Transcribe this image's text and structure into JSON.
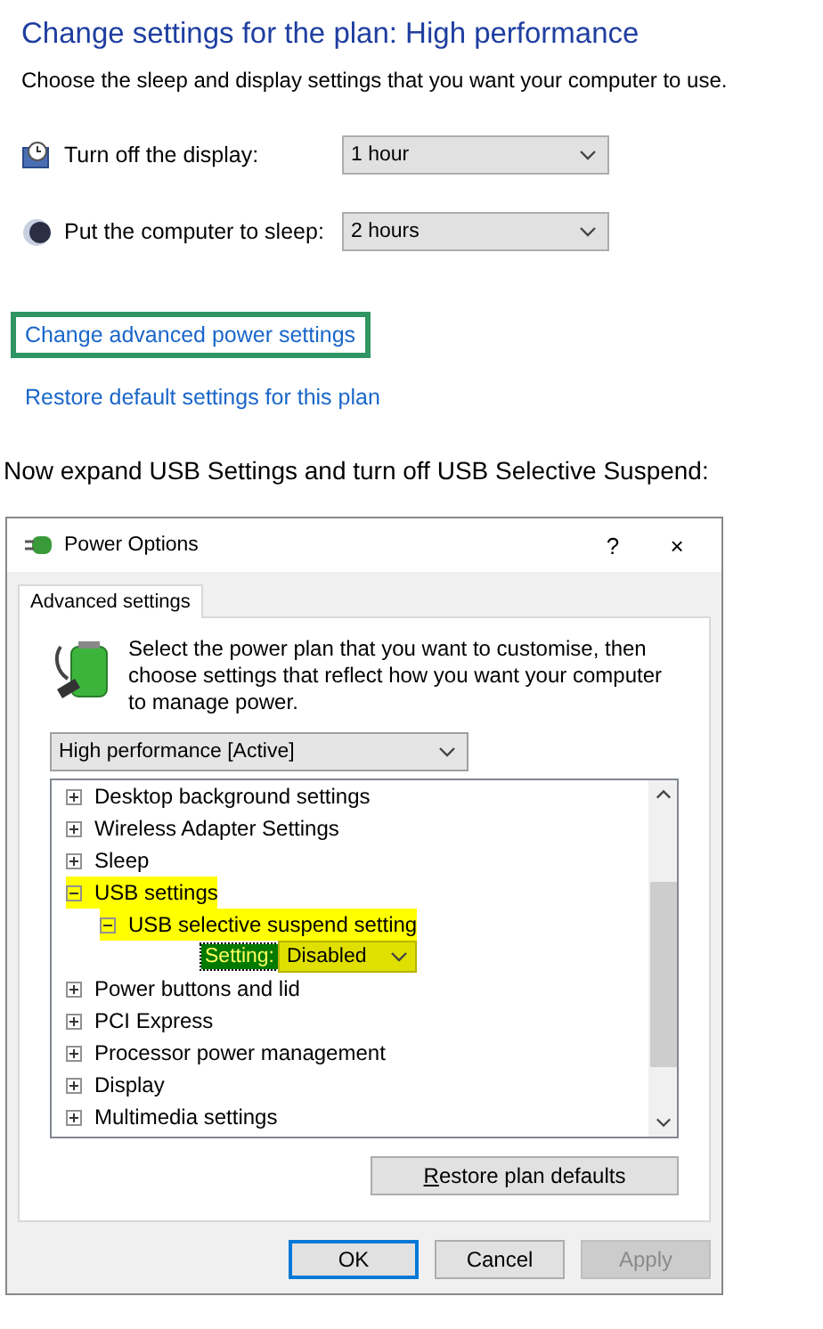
{
  "page": {
    "title": "Change settings for the plan: High performance",
    "subtitle": "Choose the sleep and display settings that you want your computer to use."
  },
  "settings": [
    {
      "kind": "display",
      "label": "Turn off the display:",
      "value": "1 hour"
    },
    {
      "kind": "sleep",
      "label": "Put the computer to sleep:",
      "value": "2 hours"
    }
  ],
  "links": [
    {
      "label": "Change advanced power settings",
      "outlined": true
    },
    {
      "label": "Restore default settings for this plan",
      "outlined": false
    }
  ],
  "instruction": "Now expand USB Settings and turn off USB Selective Suspend:",
  "dialog": {
    "title": "Power Options",
    "help": "?",
    "close": "×",
    "tabs": [
      {
        "label": "Advanced settings",
        "selected": true
      }
    ],
    "description": "Select the power plan that you want to customise, then choose settings that reflect how you want your computer to manage power.",
    "plan": "High performance [Active]",
    "tree": [
      {
        "kind": "node",
        "label": "Desktop background settings",
        "expanded": false,
        "highlighted": false
      },
      {
        "kind": "node",
        "label": "Wireless Adapter Settings",
        "expanded": false,
        "highlighted": false
      },
      {
        "kind": "node",
        "label": "Sleep",
        "expanded": false,
        "highlighted": false
      },
      {
        "kind": "node",
        "label": "USB settings",
        "expanded": true,
        "highlighted": true,
        "children": [
          {
            "kind": "node",
            "label": "USB selective suspend setting",
            "expanded": true,
            "highlighted": true,
            "children": [
              {
                "kind": "setting",
                "label": "Setting:",
                "value": "Disabled",
                "highlighted": true
              }
            ]
          }
        ]
      },
      {
        "kind": "node",
        "label": "Power buttons and lid",
        "expanded": false,
        "highlighted": false
      },
      {
        "kind": "node",
        "label": "PCI Express",
        "expanded": false,
        "highlighted": false
      },
      {
        "kind": "node",
        "label": "Processor power management",
        "expanded": false,
        "highlighted": false
      },
      {
        "kind": "node",
        "label": "Display",
        "expanded": false,
        "highlighted": false
      },
      {
        "kind": "node",
        "label": "Multimedia settings",
        "expanded": false,
        "highlighted": false
      }
    ],
    "restore_button": {
      "label": "Restore plan defaults"
    },
    "buttons": [
      {
        "label": "OK",
        "default": true,
        "disabled": false
      },
      {
        "label": "Cancel",
        "default": false,
        "disabled": false
      },
      {
        "label": "Apply",
        "default": false,
        "disabled": true
      }
    ]
  }
}
